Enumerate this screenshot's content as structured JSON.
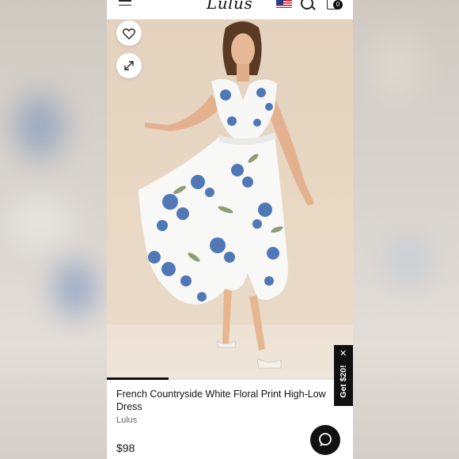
{
  "header": {
    "logo_text": "Lulus",
    "cart_count": "0"
  },
  "product": {
    "title": "French Countryside White Floral Print High-Low Dress",
    "brand": "Lulus",
    "price": "$98"
  },
  "promo": {
    "close_label": "✕",
    "label": "Get $20!"
  },
  "carousel": {
    "position": 1,
    "progress_fraction": 0.25
  },
  "colors": {
    "accent": "#111111",
    "print_blue": "#3e6bb0",
    "background_blur": "#d9d6d2"
  },
  "icons": [
    "menu-icon",
    "flag-icon",
    "search-icon",
    "bag-icon",
    "heart-icon",
    "expand-icon",
    "close-icon",
    "chat-icon"
  ]
}
